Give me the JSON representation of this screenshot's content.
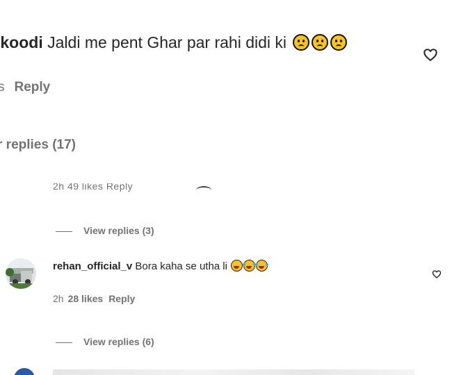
{
  "top_comment": {
    "username": "ikoodi",
    "text": "Jaldi me pent Ghar par rahi didi ki",
    "emojis": [
      "sad-face",
      "sad-face",
      "sad-face"
    ],
    "meta_time": "s",
    "reply_label": "Reply",
    "view_replies_label": "r replies (17)"
  },
  "cutoff_row": {
    "text": "2h   49 likes   Reply"
  },
  "thread1": {
    "view_replies_label": "View replies (3)"
  },
  "comment2": {
    "username": "rehan_official_v",
    "text": "Bora kaha se utha li",
    "emojis": [
      "face-savoring-food",
      "rolling-on-floor-laughing",
      "rolling-on-floor-laughing"
    ],
    "time": "2h",
    "likes": "28 likes",
    "reply_label": "Reply",
    "view_replies_label": "View replies (6)"
  },
  "colors": {
    "text": "#262626",
    "secondary": "#737373",
    "emoji_yellow": "#f7c31d"
  }
}
